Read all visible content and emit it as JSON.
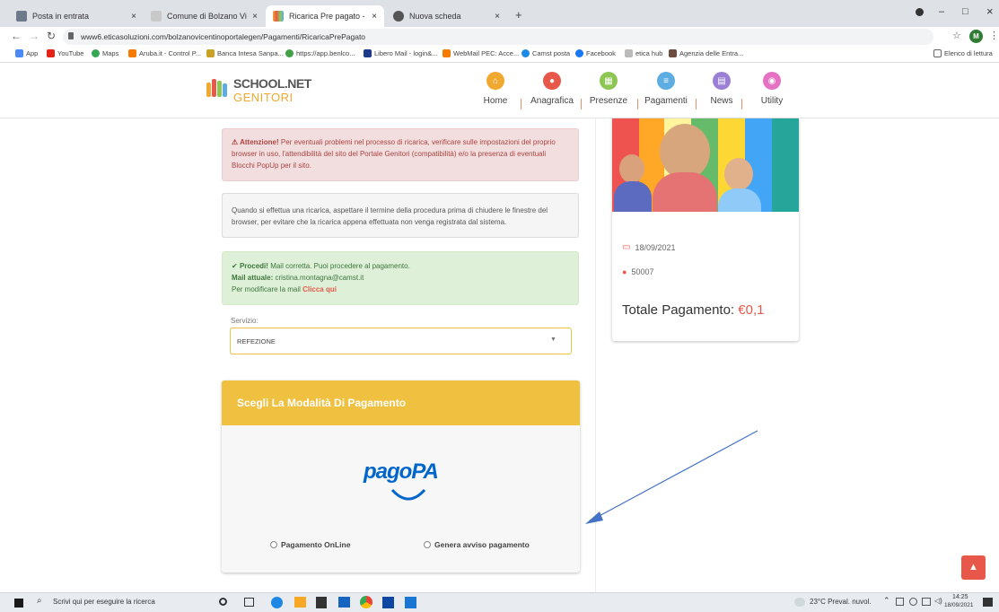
{
  "browser": {
    "tabs": [
      {
        "label": "Posta in entrata",
        "close": "×"
      },
      {
        "label": "Comune di Bolzano Vicentino - …",
        "close": "×"
      },
      {
        "label": "Ricarica Pre pagato - BOLZANO",
        "close": "×"
      },
      {
        "label": "Nuova scheda",
        "close": "×"
      }
    ],
    "new_tab": "+",
    "window_controls": [
      "–",
      "□",
      "×"
    ],
    "url": "www6.eticasoluzioni.com/bolzanovicentinoportalegen/Pagamenti/RicaricaPrePagato",
    "profile_initial": "M",
    "bookmarks": [
      "App",
      "YouTube",
      "Maps",
      "Aruba.it - Control P...",
      "Banca Intesa Sanpa...",
      "https://app.benlco...",
      "Libero Mail - login&...",
      "WebMail PEC: Acce...",
      "Camst posta",
      "Facebook",
      "etica hub",
      "Agenzia delle Entra..."
    ],
    "reading_list": "Elenco di lettura"
  },
  "site": {
    "logo_line1": "SCHOOL.NET",
    "logo_line2": "GENITORI",
    "nav": [
      {
        "label": "Home",
        "color": "#f0a830"
      },
      {
        "label": "Anagrafica",
        "color": "#e8584a"
      },
      {
        "label": "Presenze",
        "color": "#8ec653"
      },
      {
        "label": "Pagamenti",
        "color": "#5dade2"
      },
      {
        "label": "News",
        "color": "#9b7fd4"
      },
      {
        "label": "Utility",
        "color": "#e571c3"
      }
    ]
  },
  "alerts": {
    "warning_title": "Attenzione!",
    "warning_text": "Per eventuali problemi nel processo di ricarica, verificare sulle impostazioni del proprio browser in uso, l'attendibilità del sito del Portale Genitori (compatibilità) e/o la presenza di eventuali Blocchi PopUp per il sito.",
    "info_text": "Quando si effettua una ricarica, aspettare il termine della procedura prima di chiudere le finestre del browser, per evitare che la ricarica appena effettuata non venga registrata dal sistema.",
    "success_title": "Procedi!",
    "success_text": "Mail corretta. Puoi procedere al pagamento.",
    "mail_label": "Mail attuale:",
    "mail_value": "cristina.montagna@camst.it",
    "modify_text": "Per modificare la mail",
    "modify_link": "Clicca qui"
  },
  "form": {
    "service_label": "Servizio:",
    "service_value": "REFEZIONE"
  },
  "payment": {
    "header": "Scegli La Modalità Di Pagamento",
    "logo": "pagoPA",
    "option_online": "Pagamento OnLine",
    "option_notice": "Genera avviso pagamento"
  },
  "summary": {
    "date": "18/09/2021",
    "code": "50007",
    "total_label": "Totale Pagamento:",
    "total_value": "€0,1"
  },
  "taskbar": {
    "search_placeholder": "Scrivi qui per eseguire la ricerca",
    "weather": "23°C Preval. nuvol.",
    "time": "14:25",
    "date": "18/09/2021"
  },
  "colors": {
    "accent_yellow": "#f0c040",
    "total_red": "#e8584a",
    "annotation_arrow": "#4472c4",
    "scroll_top": "#e8584a"
  }
}
